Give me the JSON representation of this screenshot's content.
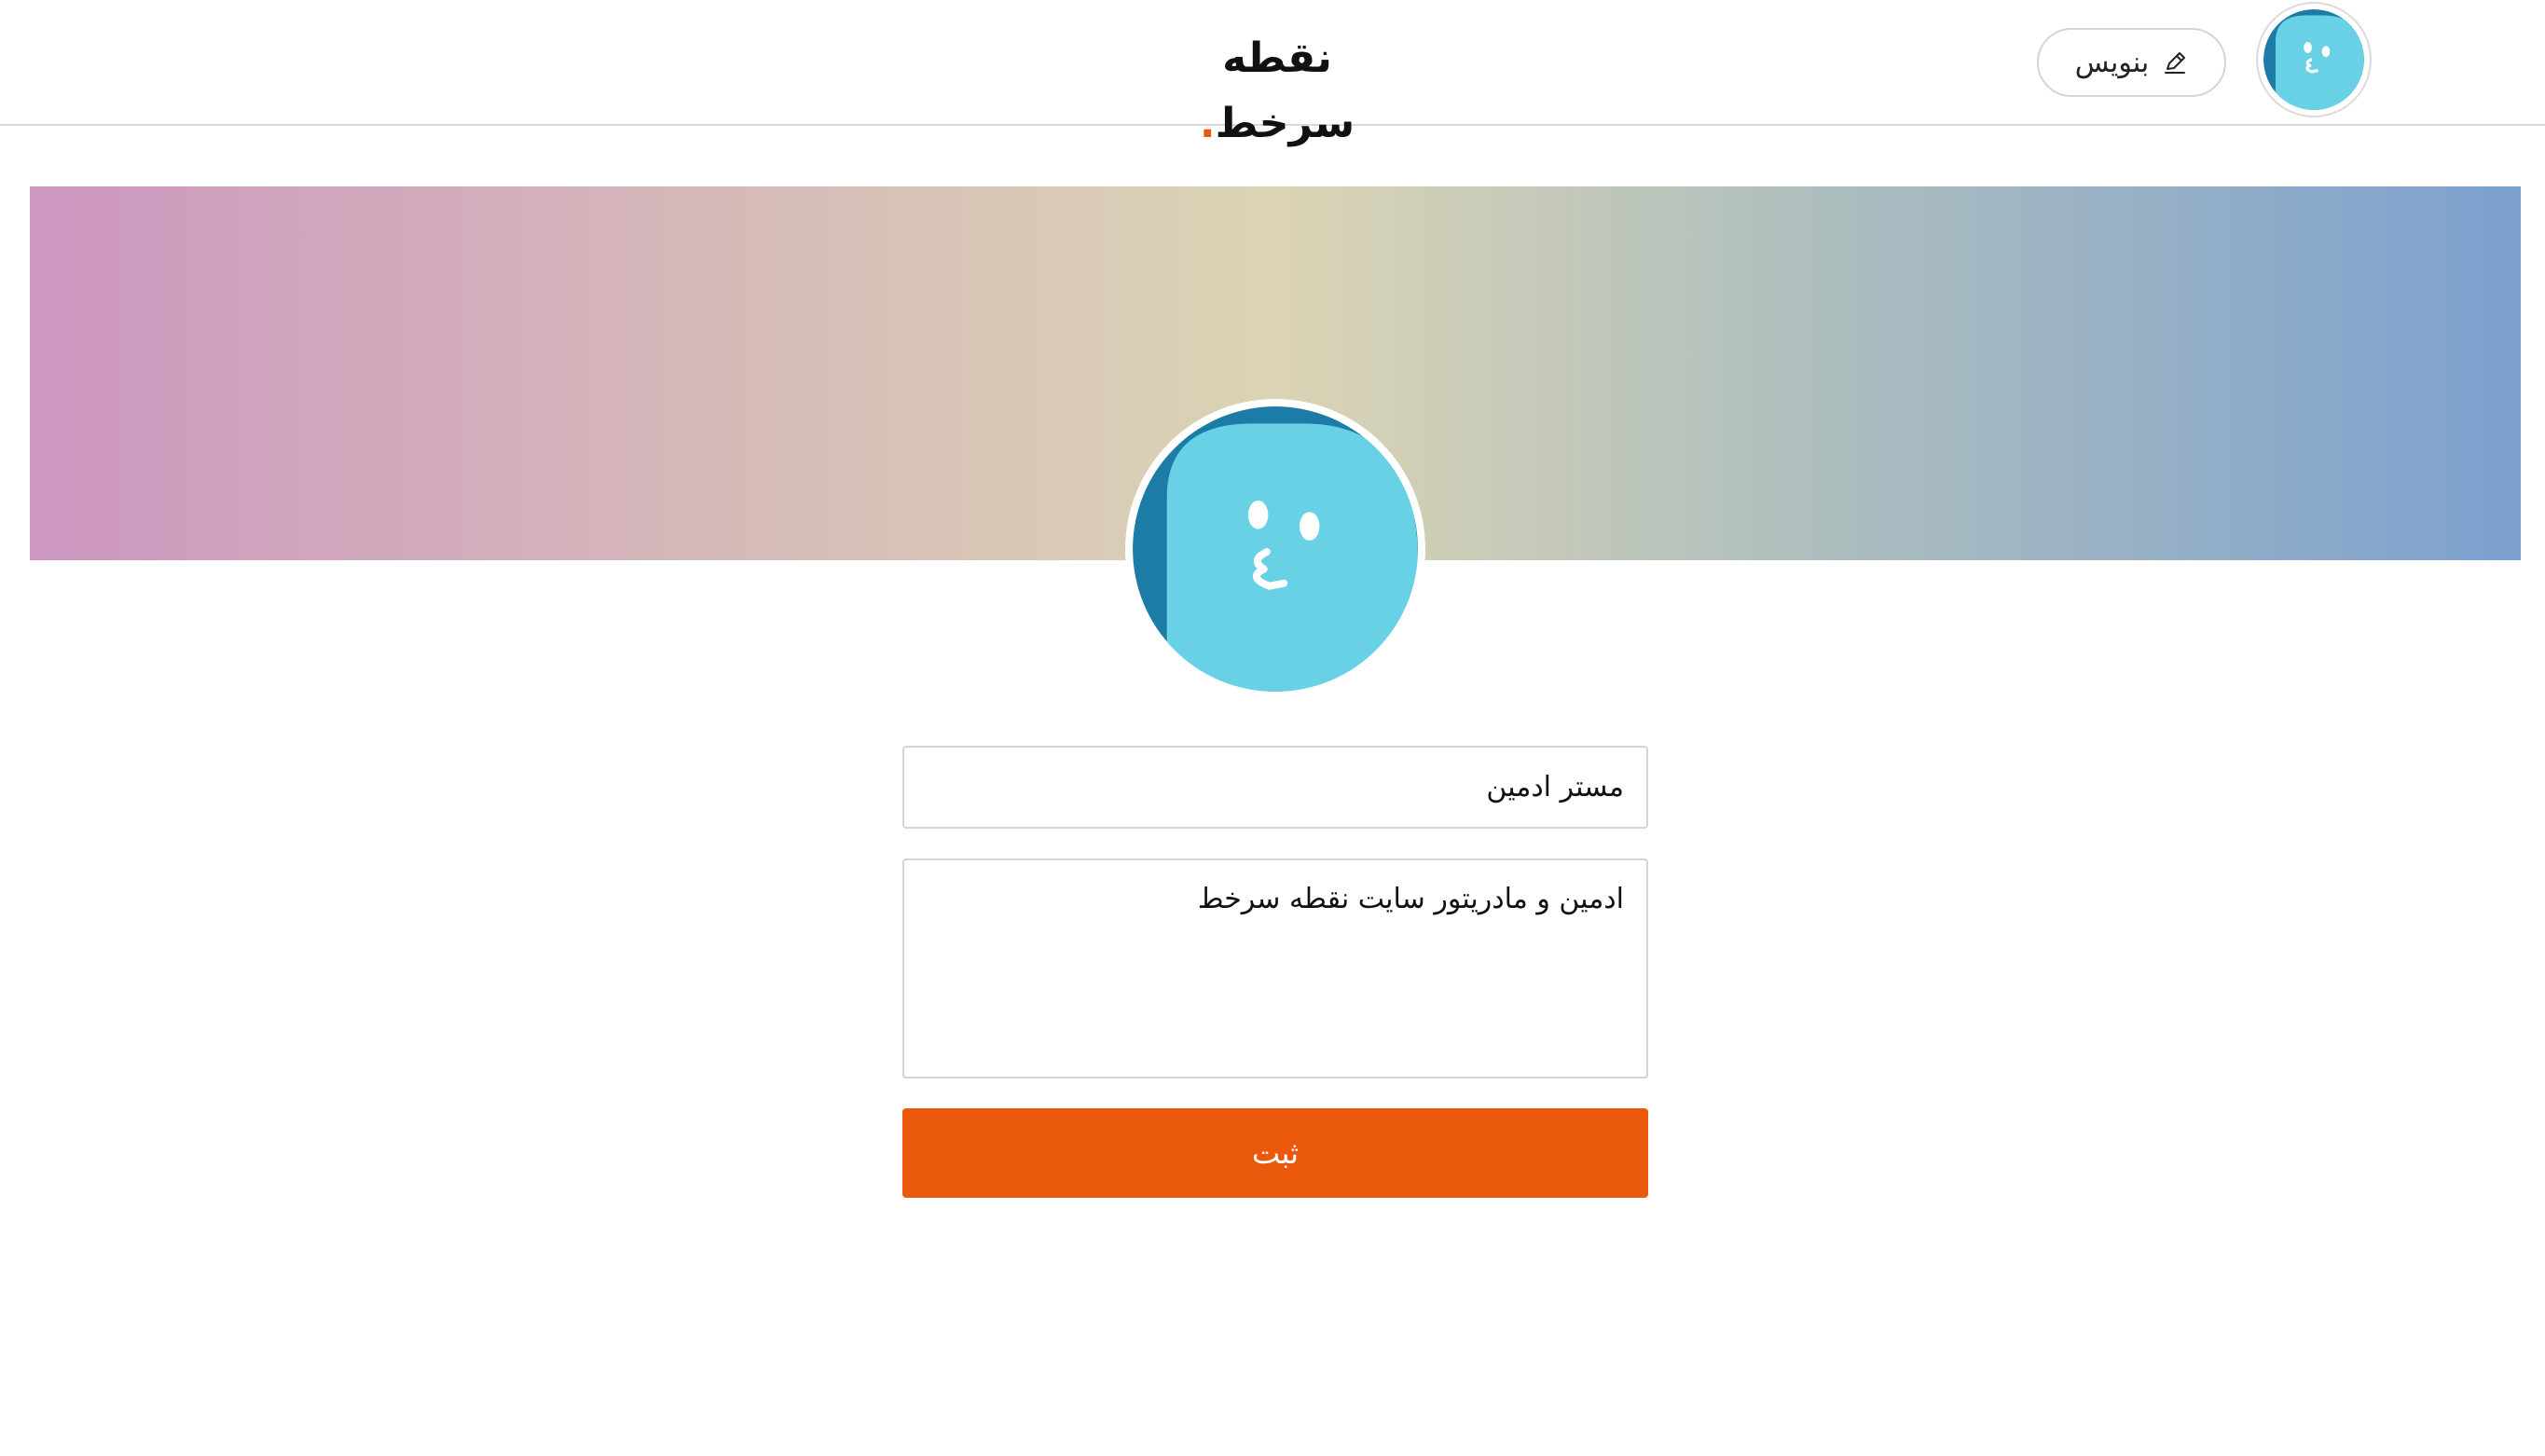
{
  "header": {
    "brand_name": "نقطه سرخط",
    "brand_dot": ".",
    "write_label": "بنویس",
    "write_icon": "pencil-icon",
    "avatar_icon": "user-avatar"
  },
  "profile": {
    "avatar_icon": "user-avatar",
    "name_value": "مستر ادمین",
    "bio_value": "ادمین و مادریتور سایت نقطه سرخط",
    "submit_label": "ثبت"
  },
  "colors": {
    "accent": "#ea580c",
    "avatar_light": "#68d1e6",
    "avatar_dark": "#1d7ca5",
    "banner_gradient": [
      "#cd97c0",
      "#d6bcb8",
      "#dbd4b4",
      "#b1c0bd",
      "#7ca0cf"
    ]
  }
}
